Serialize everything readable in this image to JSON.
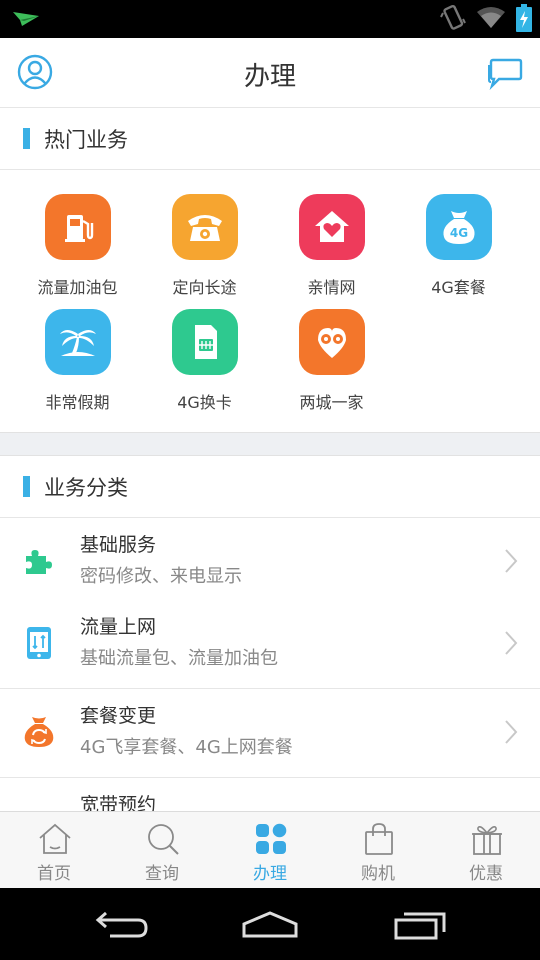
{
  "header": {
    "title": "办理"
  },
  "hot_section": {
    "title": "热门业务"
  },
  "hot_items": [
    {
      "label": "流量加油包",
      "color": "#f3762b",
      "icon": "fuel-pump-icon"
    },
    {
      "label": "定向长途",
      "color": "#f6a530",
      "icon": "telephone-icon"
    },
    {
      "label": "亲情网",
      "color": "#ee3b5b",
      "icon": "heart-house-icon"
    },
    {
      "label": "4G套餐",
      "color": "#3db6eb",
      "icon": "money-bag-4g-icon"
    },
    {
      "label": "非常假期",
      "color": "#3db6eb",
      "icon": "palm-island-icon"
    },
    {
      "label": "4G换卡",
      "color": "#2ec98f",
      "icon": "sim-card-icon"
    },
    {
      "label": "两城一家",
      "color": "#f3762b",
      "icon": "location-pin-icon"
    }
  ],
  "hot_item_4g_text": "4G",
  "category_section": {
    "title": "业务分类"
  },
  "categories": [
    {
      "title": "基础服务",
      "subtitle": "密码修改、来电显示",
      "icon": "puzzle-icon",
      "color": "#2ec98f"
    },
    {
      "title": "流量上网",
      "subtitle": "基础流量包、流量加油包",
      "icon": "phone-traffic-icon",
      "color": "#3db6eb"
    },
    {
      "title": "套餐变更",
      "subtitle": "4G飞享套餐、4G上网套餐",
      "icon": "money-bag-swap-icon",
      "color": "#f3762b"
    },
    {
      "title": "宽带预约",
      "subtitle": "",
      "icon": "broadband-icon",
      "color": "#3db6eb"
    }
  ],
  "tabs": [
    {
      "label": "首页",
      "icon": "home-icon",
      "active": false
    },
    {
      "label": "查询",
      "icon": "search-icon",
      "active": false
    },
    {
      "label": "办理",
      "icon": "grid-icon",
      "active": true
    },
    {
      "label": "购机",
      "icon": "shopping-bag-icon",
      "active": false
    },
    {
      "label": "优惠",
      "icon": "gift-icon",
      "active": false
    }
  ],
  "colors": {
    "accent": "#39a9e3",
    "section_bar": "#3ab0e5"
  }
}
